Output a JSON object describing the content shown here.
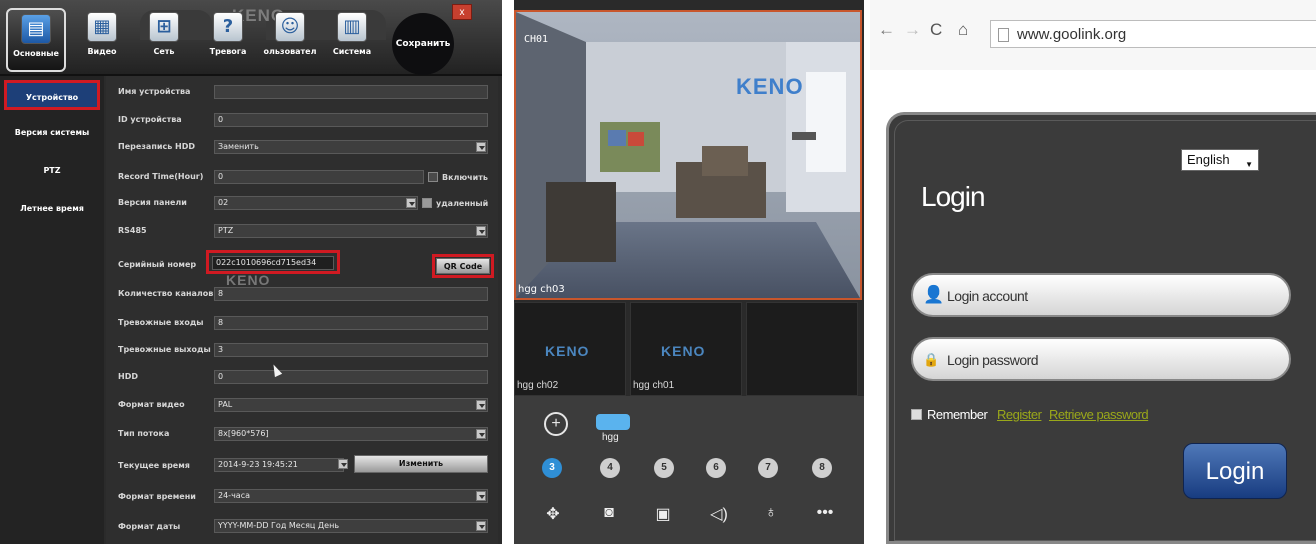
{
  "dvr": {
    "close_label": "x",
    "top_icons": [
      {
        "label": "Основные",
        "icon": "home-icon"
      },
      {
        "label": "Видео",
        "icon": "video-icon"
      },
      {
        "label": "Сеть",
        "icon": "network-icon"
      },
      {
        "label": "Тревога",
        "icon": "alarm-icon"
      },
      {
        "label": "ользовател",
        "icon": "user-icon"
      },
      {
        "label": "Система",
        "icon": "system-icon"
      }
    ],
    "watermark": "KENO",
    "save_label": "Сохранить",
    "sidebar": [
      {
        "label": "Устройство",
        "active": true
      },
      {
        "label": "Версия системы",
        "active": false
      },
      {
        "label": "PTZ",
        "active": false
      },
      {
        "label": "Летнее время",
        "active": false
      }
    ],
    "rows": [
      {
        "label": "Имя устройства",
        "value": ""
      },
      {
        "label": "ID устройства",
        "value": "0"
      },
      {
        "label": "Перезапись HDD",
        "value": "Заменить"
      },
      {
        "label": "Record Time(Hour)",
        "value": "0",
        "check_label": "Включить"
      },
      {
        "label": "Версия панели",
        "value": "02",
        "check_label": "удаленный"
      },
      {
        "label": "RS485",
        "value": "PTZ"
      },
      {
        "label": "Серийный номер",
        "value": "022c1010696cd715ed34",
        "button": "QR Code"
      },
      {
        "label": "Количество каналов",
        "value": "8"
      },
      {
        "label": "Тревожные входы",
        "value": "8"
      },
      {
        "label": "Тревожные выходы",
        "value": "3"
      },
      {
        "label": "HDD",
        "value": "0"
      },
      {
        "label": "Формат видео",
        "value": "PAL"
      },
      {
        "label": "Тип потока",
        "value": "8x[960*576]"
      },
      {
        "label": "Текущее время",
        "value": "2014-9-23 19:45:21",
        "button": "Изменить"
      },
      {
        "label": "Формат времени",
        "value": "24-часа"
      },
      {
        "label": "Формат даты",
        "value": "YYYY-MM-DD Год Месяц День"
      }
    ],
    "field_watermark": "KENO"
  },
  "mobile": {
    "main_channel": "CH01",
    "main_caption": "hgg ch03",
    "wall_logo": "KENO",
    "thumbs": [
      {
        "logo": "KENO",
        "caption": "hgg ch02"
      },
      {
        "logo": "KENO",
        "caption": "hgg ch01"
      },
      {
        "logo": "",
        "caption": ""
      }
    ],
    "device_label": "hgg",
    "numbers": [
      "3",
      "4",
      "5",
      "6",
      "7",
      "8"
    ],
    "active_number": "3",
    "bottom_icons": [
      "move-icon",
      "camera-icon",
      "record-icon",
      "speaker-icon",
      "microphone-icon",
      "more-icon"
    ]
  },
  "browser": {
    "url": "www.goolink.org",
    "language": "English",
    "title": "Login",
    "account_placeholder": "Login account",
    "password_placeholder": "Login password",
    "remember_label": "Remember",
    "register_link": "Register",
    "retrieve_link": "Retrieve password",
    "login_button": "Login"
  }
}
